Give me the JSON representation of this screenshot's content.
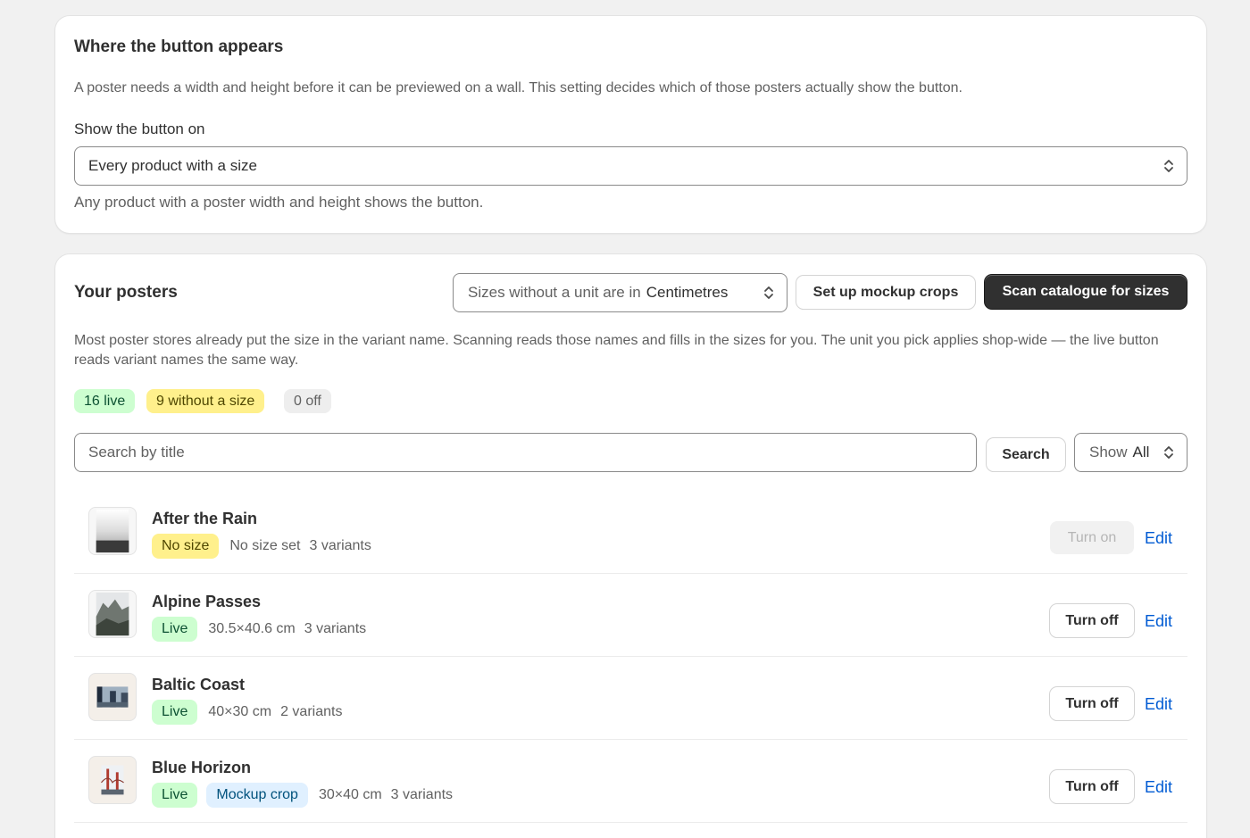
{
  "placement": {
    "title": "Where the button appears",
    "description": "A poster needs a width and height before it can be previewed on a wall. This setting decides which of those posters actually show the button.",
    "select_label": "Show the button on",
    "select_value": "Every product with a size",
    "help_text": "Any product with a poster width and height shows the button."
  },
  "posters": {
    "title": "Your posters",
    "unit_select": {
      "prefix": "Sizes without a unit are in",
      "value": "Centimetres"
    },
    "mockup_button": "Set up mockup crops",
    "scan_button": "Scan catalogue for sizes",
    "description": "Most poster stores already put the size in the variant name. Scanning reads those names and fills in the sizes for you. The unit you pick applies shop-wide — the live button reads variant names the same way.",
    "summary": {
      "live": "16 live",
      "no_size": "9 without a size",
      "off": "0 off"
    },
    "search": {
      "placeholder": "Search by title",
      "button": "Search"
    },
    "filter": {
      "prefix": "Show",
      "value": "All"
    },
    "items": [
      {
        "title": "After the Rain",
        "status": "No size",
        "crop": "",
        "size": "No size set",
        "variants": "3 variants",
        "action": "Turn on",
        "edit": "Edit"
      },
      {
        "title": "Alpine Passes",
        "status": "Live",
        "crop": "",
        "size": "30.5×40.6 cm",
        "variants": "3 variants",
        "action": "Turn off",
        "edit": "Edit"
      },
      {
        "title": "Baltic Coast",
        "status": "Live",
        "crop": "",
        "size": "40×30 cm",
        "variants": "2 variants",
        "action": "Turn off",
        "edit": "Edit"
      },
      {
        "title": "Blue Horizon",
        "status": "Live",
        "crop": "Mockup crop",
        "size": "30×40 cm",
        "variants": "3 variants",
        "action": "Turn off",
        "edit": "Edit"
      }
    ]
  },
  "colors": {
    "accent_dark": "#303030",
    "link": "#005bd3",
    "live_bg": "#cdfed0",
    "warn_bg": "#fff08c",
    "info_bg": "#e0f0ff"
  }
}
